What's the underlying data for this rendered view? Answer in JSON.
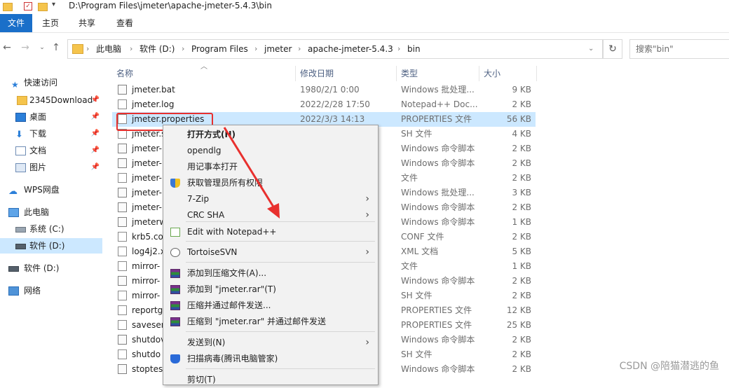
{
  "title_bar": {
    "path": "D:\\Program Files\\jmeter\\apache-jmeter-5.4.3\\bin"
  },
  "ribbon": {
    "tabs": [
      "文件",
      "主页",
      "共享",
      "查看"
    ]
  },
  "address": {
    "crumbs": [
      "此电脑",
      "软件 (D:)",
      "Program Files",
      "jmeter",
      "apache-jmeter-5.4.3",
      "bin"
    ],
    "search_placeholder": "搜索\"bin\""
  },
  "sidebar": {
    "items": [
      {
        "label": "快速访问",
        "icon": "star-icon",
        "pinned": false
      },
      {
        "label": "2345Download",
        "icon": "folder-icon",
        "pinned": true
      },
      {
        "label": "桌面",
        "icon": "desktop-icon",
        "pinned": true
      },
      {
        "label": "下载",
        "icon": "download-icon",
        "pinned": true
      },
      {
        "label": "文档",
        "icon": "document-icon",
        "pinned": true
      },
      {
        "label": "图片",
        "icon": "picture-icon",
        "pinned": true
      },
      {
        "label": "WPS网盘",
        "icon": "cloud-icon",
        "pinned": false
      },
      {
        "label": "此电脑",
        "icon": "computer-icon",
        "pinned": false
      },
      {
        "label": "系统 (C:)",
        "icon": "drive-icon",
        "pinned": false
      },
      {
        "label": "软件 (D:)",
        "icon": "drive-icon",
        "pinned": false
      },
      {
        "label": "软件 (D:)",
        "icon": "drive-icon",
        "pinned": false
      },
      {
        "label": "网络",
        "icon": "network-icon",
        "pinned": false
      }
    ]
  },
  "columns": {
    "name": "名称",
    "date": "修改日期",
    "type": "类型",
    "size": "大小"
  },
  "files": [
    {
      "name": "jmeter.bat",
      "date": "1980/2/1 0:00",
      "type": "Windows 批处理...",
      "size": "9 KB"
    },
    {
      "name": "jmeter.log",
      "date": "2022/2/28 17:50",
      "type": "Notepad++ Doc...",
      "size": "2 KB"
    },
    {
      "name": "jmeter.properties",
      "date": "2022/3/3 14:13",
      "type": "PROPERTIES 文件",
      "size": "56 KB"
    },
    {
      "name": "jmeter.s",
      "date": "",
      "type": "SH 文件",
      "size": "4 KB"
    },
    {
      "name": "jmeter-",
      "date": "",
      "type": "Windows 命令脚本",
      "size": "2 KB"
    },
    {
      "name": "jmeter-",
      "date": "",
      "type": "Windows 命令脚本",
      "size": "2 KB"
    },
    {
      "name": "jmeter-",
      "date": "",
      "type": "文件",
      "size": "2 KB"
    },
    {
      "name": "jmeter-",
      "date": "",
      "type": "Windows 批处理...",
      "size": "3 KB"
    },
    {
      "name": "jmeter-",
      "date": "",
      "type": "Windows 命令脚本",
      "size": "2 KB"
    },
    {
      "name": "jmeterw",
      "date": "",
      "type": "Windows 命令脚本",
      "size": "1 KB"
    },
    {
      "name": "krb5.co",
      "date": "",
      "type": "CONF 文件",
      "size": "2 KB"
    },
    {
      "name": "log4j2.x",
      "date": "",
      "type": "XML 文档",
      "size": "5 KB"
    },
    {
      "name": "mirror-",
      "date": "",
      "type": "文件",
      "size": "1 KB"
    },
    {
      "name": "mirror-",
      "date": "",
      "type": "Windows 命令脚本",
      "size": "2 KB"
    },
    {
      "name": "mirror-",
      "date": "",
      "type": "SH 文件",
      "size": "2 KB"
    },
    {
      "name": "reportg",
      "date": "",
      "type": "PROPERTIES 文件",
      "size": "12 KB"
    },
    {
      "name": "saveser",
      "date": "",
      "type": "PROPERTIES 文件",
      "size": "25 KB"
    },
    {
      "name": "shutdov",
      "date": "",
      "type": "Windows 命令脚本",
      "size": "2 KB"
    },
    {
      "name": "shutdo",
      "date": "",
      "type": "SH 文件",
      "size": "2 KB"
    },
    {
      "name": "stoptes",
      "date": "",
      "type": "Windows 命令脚本",
      "size": "2 KB"
    }
  ],
  "context_menu": {
    "items": [
      {
        "label": "打开方式(H)",
        "bold": true,
        "icon": "",
        "submenu": false
      },
      {
        "label": "opendlg",
        "icon": "",
        "submenu": false
      },
      {
        "label": "用记事本打开",
        "icon": "",
        "submenu": false
      },
      {
        "label": "获取管理员所有权限",
        "icon": "uac-shield-icon",
        "submenu": false
      },
      {
        "label": "7-Zip",
        "icon": "",
        "submenu": true
      },
      {
        "label": "CRC SHA",
        "icon": "",
        "submenu": true
      },
      {
        "label": "Edit with Notepad++",
        "icon": "notepad-plus-plus-icon",
        "submenu": false
      },
      {
        "label": "TortoiseSVN",
        "icon": "tortoise-svn-icon",
        "submenu": true
      },
      {
        "label": "添加到压缩文件(A)...",
        "icon": "winrar-icon",
        "submenu": false
      },
      {
        "label": "添加到 \"jmeter.rar\"(T)",
        "icon": "winrar-icon",
        "submenu": false
      },
      {
        "label": "压缩并通过邮件发送...",
        "icon": "winrar-icon",
        "submenu": false
      },
      {
        "label": "压缩到 \"jmeter.rar\" 并通过邮件发送",
        "icon": "winrar-icon",
        "submenu": false
      },
      {
        "label": "发送到(N)",
        "icon": "",
        "submenu": true
      },
      {
        "label": "扫描病毒(腾讯电脑管家)",
        "icon": "tencent-shield-icon",
        "submenu": false
      },
      {
        "label": "剪切(T)",
        "icon": "",
        "submenu": false
      }
    ]
  },
  "watermark": "CSDN @陪猫潜逃的鱼",
  "colors": {
    "accent": "#1a6fc9",
    "selection": "#cce8ff",
    "highlight_box": "#e8302e"
  }
}
